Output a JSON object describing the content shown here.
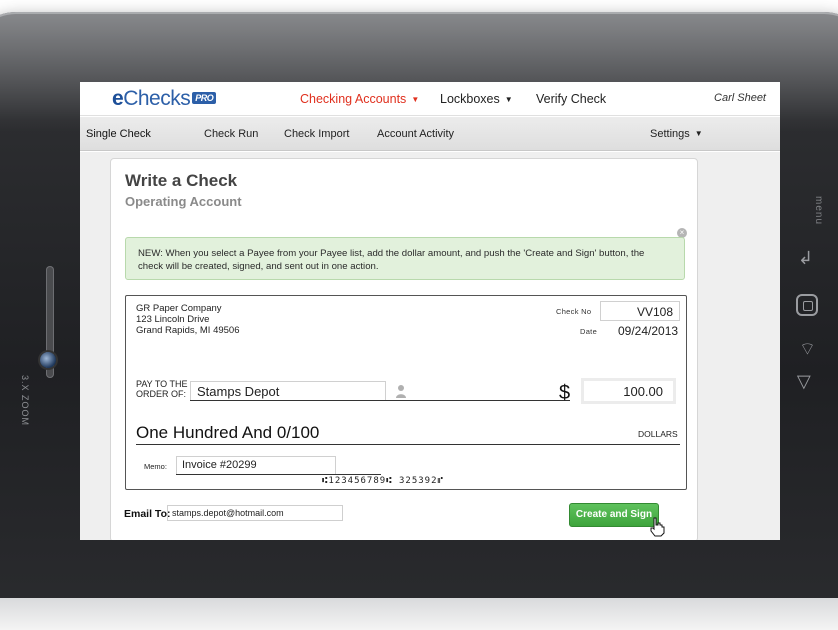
{
  "device": {
    "zoom_label": "3.X ZOOM",
    "side_menu_label": "menu",
    "icons": [
      "back-icon",
      "home-icon",
      "search-icon",
      "up-icon"
    ]
  },
  "header": {
    "logo_e": "e",
    "logo_text": "Checks",
    "logo_badge": "PRO",
    "nav": [
      {
        "label": "Checking Accounts",
        "active": true
      },
      {
        "label": "Lockboxes",
        "active": false
      },
      {
        "label": "Verify Check",
        "active": false
      }
    ],
    "user": "Carl Sheet"
  },
  "subnav": {
    "items": [
      "Single Check",
      "Check Run",
      "Check Import",
      "Account Activity"
    ],
    "settings": "Settings"
  },
  "page": {
    "title": "Write a Check",
    "subtitle": "Operating Account",
    "notice": "NEW: When you select a Payee from your Payee list, add the dollar amount, and push the 'Create and Sign' button, the check will be created, signed, and sent out in one action."
  },
  "check": {
    "payer_name": "GR Paper Company",
    "payer_address1": "123 Lincoln Drive",
    "payer_address2": "Grand Rapids, MI 49506",
    "check_no_label": "Check No",
    "check_no": "VV108",
    "date_label": "Date",
    "date": "09/24/2013",
    "pay_to_label1": "PAY TO THE",
    "pay_to_label2": "ORDER OF:",
    "payee": "Stamps Depot",
    "currency_symbol": "$",
    "amount": "100.00",
    "amount_words": "One Hundred And 0/100",
    "dollars_label": "DOLLARS",
    "memo_label": "Memo:",
    "memo": "Invoice #20299",
    "micr_line": "⑆123456789⑆  325392⑈"
  },
  "footer": {
    "email_label": "Email To:",
    "email": "stamps.depot@hotmail.com",
    "create_button": "Create and Sign"
  },
  "colors": {
    "brand_blue": "#2c5fa8",
    "nav_active_red": "#e0301e",
    "notice_green_bg": "#e2f1dc",
    "button_green": "#4cb44a"
  }
}
